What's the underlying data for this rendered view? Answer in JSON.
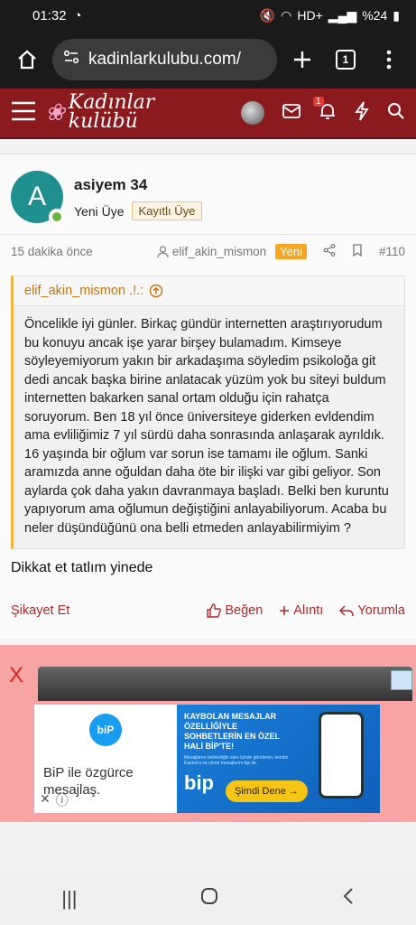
{
  "status": {
    "time": "01:32",
    "battery": "%24",
    "network": "HD+"
  },
  "browser": {
    "url": "kadinlarkulubu.com/",
    "tab_count": "1"
  },
  "site": {
    "logo_line1": "Kadınlar",
    "logo_line2": "kulübü",
    "alert_count": "1"
  },
  "post": {
    "author_initial": "A",
    "author_name": "asiyem 34",
    "user_title": "Yeni Üye",
    "user_badge": "Kayıtlı Üye",
    "time": "15 dakika önce",
    "thread_author": "elif_akin_mismon",
    "new_label": "Yeni",
    "post_number": "#110",
    "quote_author": "elif_akin_mismon .!.:",
    "quote_text": "Öncelikle iyi günler. Birkaç gündür internetten araştırıyorudum bu konuyu ancak işe yarar birşey bulamadım. Kimseye söyleyemiyorum yakın bir arkadaşıma söyledim psikoloğa git dedi ancak başka birine anlatacak yüzüm yok bu siteyi buldum internetten bakarken sanal ortam olduğu için rahatça soruyorum. Ben 18 yıl önce üniversiteye giderken evldendim ama evliliğimiz 7 yıl sürdü daha sonrasında anlaşarak ayrıldık. 16 yaşında bir oğlum var sorun ise tamamı ile oğlum. Sanki aramızda anne oğuldan daha öte bir ilişki var gibi geliyor. Son aylarda çok daha yakın davranmaya başladı. Belki ben kuruntu yapıyorum ama oğlumun değiştiğini anlayabiliyorum. Acaba bu neler düşündüğünü ona belli etmeden anlayabilirmiyim ?",
    "reply": "Dikkat et tatlım yinede",
    "report_label": "Şikayet Et",
    "like_label": "Beğen",
    "quote_label": "Alıntı",
    "reply_label": "Yorumla"
  },
  "ad": {
    "close_label": "X",
    "brand": "biP",
    "left_text": "BiP ile özgürce mesajlaş.",
    "headline": "KAYBOLAN MESAJLAR ÖZELLİĞİYLE SOHBETLERİN EN ÖZEL HALİ BİP'TE!",
    "smalltext": "Mesajlarını belirlediğin süre içinde gönderen, kendin Kaybol'a ve yönet mesajlarını bip ile.",
    "brand2": "bip",
    "cta": "Şimdi Dene →"
  },
  "icons": [
    "home-icon",
    "site-info-icon",
    "plus-icon",
    "menu-dots-icon",
    "hamburger-icon",
    "mail-icon",
    "bell-icon",
    "flash-icon",
    "search-icon",
    "share-icon",
    "bookmark-icon",
    "user-icon",
    "thumbs-up-icon",
    "plus-quote-icon",
    "reply-icon"
  ]
}
